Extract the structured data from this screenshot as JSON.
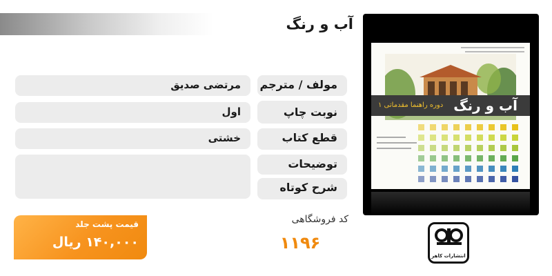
{
  "title": "آب و رنگ",
  "info_rows": [
    {
      "label": "مولف / مترجم",
      "value": "مرتضی صدیق"
    },
    {
      "label": "نوبت چاپ",
      "value": "اول"
    },
    {
      "label": "قطع کتاب",
      "value": "خشتی"
    },
    {
      "label": "توضیحات",
      "value": ""
    },
    {
      "label": "شرح کوتاه",
      "value": ""
    }
  ],
  "price": {
    "label": "قیمت پشت جلد",
    "value": "۱۴۰,۰۰۰ ریال"
  },
  "store_code": {
    "label": "کد فروشگاهی",
    "value": "۱۱۹۶"
  },
  "cover": {
    "title": "آب و رنگ",
    "subtitle": "دوره راهنما مقدماتی ۱",
    "illustration": "building-watercolor-illustration",
    "swatch_colors": [
      "#e8c21c",
      "#c9d53a",
      "#a8c63d",
      "#5aa64a",
      "#2f7fb7",
      "#3553a1"
    ]
  },
  "publisher": {
    "name": "انتشارات کاهر",
    "logo_icon": "publisher-logo-icon"
  },
  "colors": {
    "accent": "#f7931e",
    "label_bg": "#ececec"
  }
}
